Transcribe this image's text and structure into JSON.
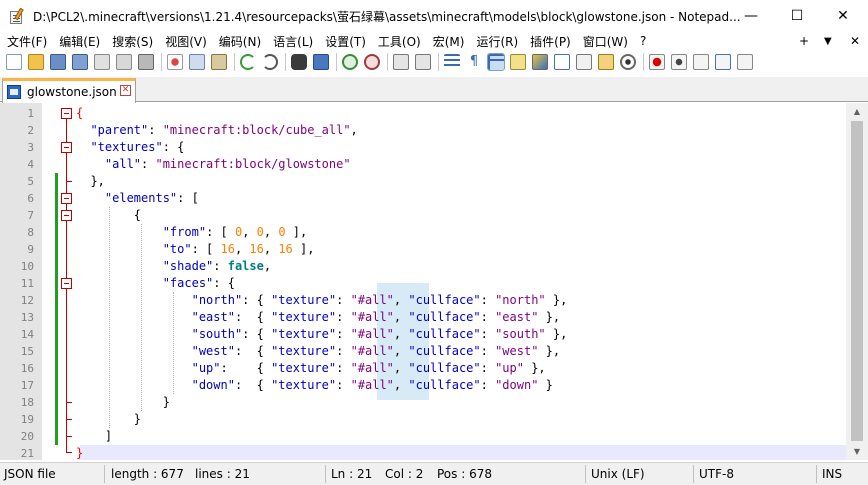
{
  "window": {
    "title": "D:\\PCL2\\.minecraft\\versions\\1.21.4\\resourcepacks\\萤石绿幕\\assets\\minecraft\\models\\block\\glowstone.json - Notepad...",
    "minimize": "—",
    "maximize": "☐",
    "close": "✕"
  },
  "menu": {
    "items": [
      "文件(F)",
      "编辑(E)",
      "搜索(S)",
      "视图(V)",
      "编码(N)",
      "语言(L)",
      "设置(T)",
      "工具(O)",
      "宏(M)",
      "运行(R)",
      "插件(P)",
      "窗口(W)",
      "?"
    ],
    "right_plus": "+",
    "right_down": "▼",
    "right_close": "✕"
  },
  "tab": {
    "label": "glowstone.json",
    "close": "✕"
  },
  "editor": {
    "line_numbers": [
      "1",
      "2",
      "3",
      "4",
      "5",
      "6",
      "7",
      "8",
      "9",
      "10",
      "11",
      "12",
      "13",
      "14",
      "15",
      "16",
      "17",
      "18",
      "19",
      "20",
      "21"
    ]
  },
  "statusbar": {
    "file_type": "JSON file",
    "length": "length : 677",
    "lines": "lines : 21",
    "ln": "Ln : 21",
    "col": "Col : 2",
    "pos": "Pos : 678",
    "eol": "Unix (LF)",
    "encoding": "UTF-8",
    "mode": "INS"
  },
  "colors": {
    "key": "#0000c0",
    "string": "#7f007f",
    "number": "#ff8000",
    "keyword": "#008080",
    "fold": "#c00000",
    "change": "#1fa01f",
    "tab_accent": "#fab44a"
  }
}
